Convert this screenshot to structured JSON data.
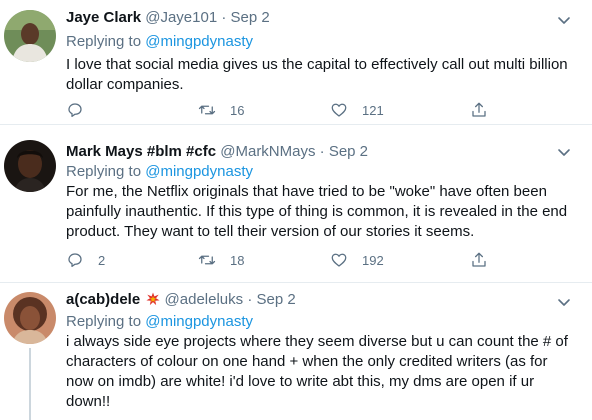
{
  "tweets": [
    {
      "name": "Jaye Clark",
      "handle": "@Jaye101",
      "date": "Sep 2",
      "separator": "·",
      "replying_prefix": "Replying to",
      "replying_to": "@mingpdynasty",
      "text": "I love that social media gives us the capital to effectively call out multi billion dollar companies.",
      "replies": "",
      "retweets": "16",
      "likes": "121"
    },
    {
      "name": "Mark Mays #blm #cfc",
      "handle": "@MarkNMays",
      "date": "Sep 2",
      "separator": "·",
      "replying_prefix": "Replying to",
      "replying_to": "@mingpdynasty",
      "text": "For me, the Netflix originals that have tried to be \"woke\" have often been painfully inauthentic. If this type of thing is common, it is revealed in the end product. They want to tell their version of our stories it seems.",
      "replies": "2",
      "retweets": "18",
      "likes": "192"
    },
    {
      "name": "a(cab)dele",
      "handle": "@adeleluks",
      "date": "Sep 2",
      "separator": "·",
      "replying_prefix": "Replying to",
      "replying_to": "@mingpdynasty",
      "text": "i always side eye projects where they seem diverse but u can count the # of characters of colour on one hand + when the only credited writers (as for now on imdb) are white! i'd love to write abt this, my dms are open if ur down!!"
    }
  ],
  "icons": {
    "reply": "reply-icon",
    "retweet": "retweet-icon",
    "like": "heart-icon",
    "share": "share-icon",
    "more": "chevron-down-icon",
    "name_emoji": "collision-emoji-icon"
  },
  "colors": {
    "name": "#0f1419",
    "secondary": "#5b7083",
    "mention": "#1b95e0",
    "divider": "#e6ecf0"
  }
}
